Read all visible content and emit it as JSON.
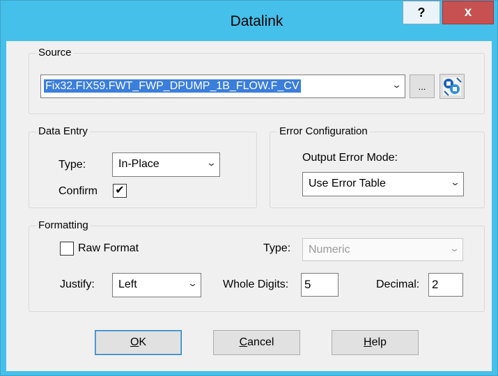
{
  "window": {
    "title": "Datalink",
    "help_label": "?",
    "close_label": "x"
  },
  "source": {
    "group_label": "Source",
    "value": "Fix32.FIX59.FWT_FWP_DPUMP_1B_FLOW.F_CV",
    "browse_label": "...",
    "icon": "datalink-browser-icon"
  },
  "data_entry": {
    "group_label": "Data Entry",
    "type_label": "Type:",
    "type_value": "In-Place",
    "confirm_label": "Confirm",
    "confirm_checked": true
  },
  "error_config": {
    "group_label": "Error Configuration",
    "mode_label": "Output Error Mode:",
    "mode_value": "Use Error Table"
  },
  "formatting": {
    "group_label": "Formatting",
    "raw_format_label": "Raw Format",
    "raw_format_checked": false,
    "type_label": "Type:",
    "type_value": "Numeric",
    "justify_label": "Justify:",
    "justify_value": "Left",
    "whole_digits_label": "Whole Digits:",
    "whole_digits_value": "5",
    "decimal_label": "Decimal:",
    "decimal_value": "2"
  },
  "buttons": {
    "ok_prefix": "O",
    "ok_rest": "K",
    "cancel_prefix": "C",
    "cancel_rest": "ancel",
    "help_prefix": "H",
    "help_rest": "elp"
  },
  "colors": {
    "titlebar": "#45c0ea",
    "close": "#c75050",
    "selection": "#3b7edc"
  }
}
